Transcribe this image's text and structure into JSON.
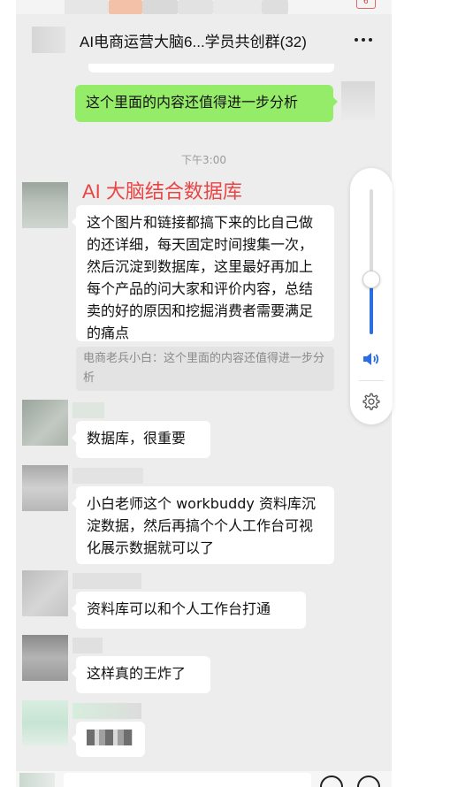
{
  "header": {
    "title": "AI电商运营大脑6...学员共创群(32)",
    "battery_label": "6"
  },
  "messages": [
    {
      "side": "right",
      "text": "这个里面的内容还值得进一步分析"
    },
    {
      "side": "left",
      "text": "这个图片和链接都搞下来的比自己做的还详细，每天固定时间搜集一次，然后沉淀到数据库，这里最好再加上每个产品的问大家和评价内容，总结卖的好的原因和挖掘消费者需要满足的痛点"
    },
    {
      "side": "left",
      "text": "数据库，很重要"
    },
    {
      "side": "left",
      "text": "小白老师这个 workbuddy 资料库沉淀数据，然后再搞个个人工作台可视化展示数据就可以了"
    },
    {
      "side": "left",
      "text": "资料库可以和个人工作台打通"
    },
    {
      "side": "left",
      "text": "这样真的王炸了"
    }
  ],
  "timestamp": "下午3:00",
  "annotation_title": "AI 大脑结合数据库",
  "quote": "电商老兵小白：这个里面的内容还值得进一步分析",
  "volume": {
    "level": 0.38
  },
  "icons": [
    "more-icon",
    "speaker-icon",
    "gear-icon",
    "emoji-icon",
    "plus-icon"
  ],
  "colors": {
    "green_bubble": "#95ec69",
    "annotation_red": "#e94545",
    "volume_blue": "#2b6de3"
  }
}
